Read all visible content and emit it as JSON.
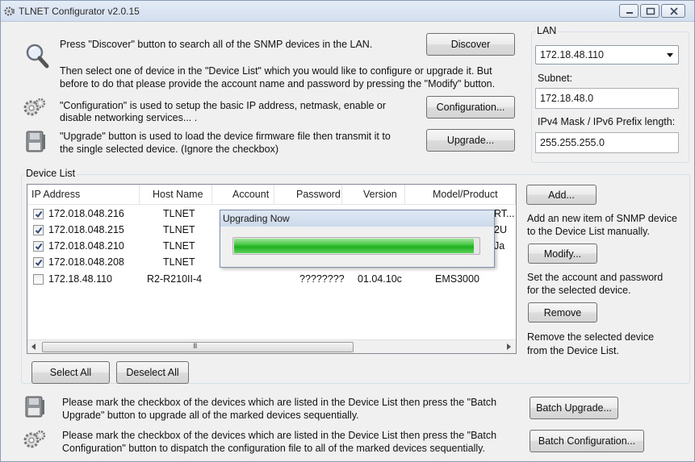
{
  "window": {
    "title": "TLNET Configurator v2.0.15"
  },
  "intro": {
    "discover_text": "Press \"Discover\" button to search all of the SNMP devices in the LAN.",
    "select_text_1": "Then select one of device in the \"Device List\" which you would like to configure or upgrade it. But",
    "select_text_2": "before to do that please provide the account name and password by pressing the \"Modify\" button.",
    "config_text_1": "\"Configuration\" is used to setup the basic IP address, netmask, enable or",
    "config_text_2": "disable networking services... .",
    "upgrade_text_1": "\"Upgrade\" button is used to load the device firmware file then transmit it to",
    "upgrade_text_2": "the single selected device. (Ignore the checkbox)"
  },
  "buttons": {
    "discover": "Discover",
    "configuration": "Configuration...",
    "upgrade": "Upgrade...",
    "add": "Add...",
    "modify": "Modify...",
    "remove": "Remove",
    "select_all": "Select All",
    "deselect_all": "Deselect All",
    "batch_upgrade": "Batch Upgrade...",
    "batch_configuration": "Batch Configuration..."
  },
  "lan": {
    "group_label": "LAN",
    "selected": "172.18.48.110",
    "subnet_label": "Subnet:",
    "subnet_value": "172.18.48.0",
    "mask_label": "IPv4 Mask / IPv6 Prefix length:",
    "mask_value": "255.255.255.0"
  },
  "device_list": {
    "group_label": "Device List",
    "columns": [
      "IP Address",
      "Host Name",
      "Account",
      "Password",
      "Version",
      "Model/Product"
    ],
    "rows": [
      {
        "checked": true,
        "ip": "172.018.048.216",
        "host": "TLNET",
        "account": "",
        "password": "",
        "version": "",
        "model": "RT..."
      },
      {
        "checked": true,
        "ip": "172.018.048.215",
        "host": "TLNET",
        "account": "",
        "password": "",
        "version": "",
        "model": "2U"
      },
      {
        "checked": true,
        "ip": "172.018.048.210",
        "host": "TLNET",
        "account": "",
        "password": "",
        "version": "",
        "model": "Ja"
      },
      {
        "checked": true,
        "ip": "172.018.048.208",
        "host": "TLNET",
        "account": "",
        "password": "",
        "version": "",
        "model": ""
      },
      {
        "checked": false,
        "ip": "172.18.48.110",
        "host": "R2-R210II-4",
        "account": "",
        "password": "????????",
        "version": "01.04.10c",
        "model": "EMS3000"
      }
    ],
    "scroll_grip": "III"
  },
  "side_help": {
    "add_text_1": "Add an new item of SNMP device",
    "add_text_2": "to the Device List manually.",
    "modify_text_1": "Set the account and password",
    "modify_text_2": "for the selected device.",
    "remove_text_1": "Remove the selected device",
    "remove_text_2": "from the Device List."
  },
  "progress_dialog": {
    "title": "Upgrading Now",
    "progress": 0.98,
    "fill_color": "#2fb52c"
  },
  "batch": {
    "upgrade_text_1": "Please mark the checkbox of the devices which are listed in the Device List then press the \"Batch",
    "upgrade_text_2": "Upgrade\" button to upgrade all of the marked devices sequentially.",
    "config_text_1": "Please mark the checkbox of the devices which are listed in the Device List then press the \"Batch",
    "config_text_2": "Configuration\" button to dispatch the configuration file to all of the marked devices sequentially."
  },
  "icons": {
    "app": "gear-icon",
    "discover": "magnifier-icon",
    "configuration": "gear-icon",
    "upgrade": "disk-icon"
  }
}
